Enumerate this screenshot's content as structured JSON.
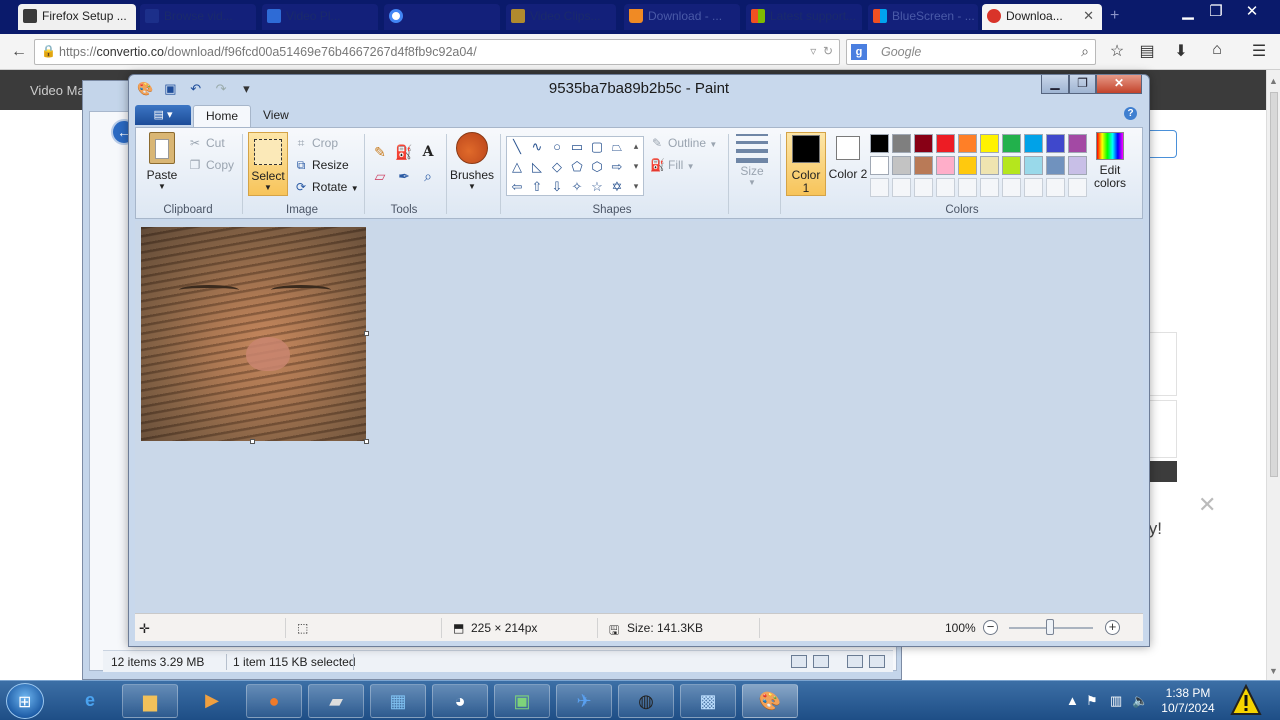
{
  "browser": {
    "tabs": [
      {
        "label": "Firefox Setup ...",
        "icon_color": "#3a3a3a"
      },
      {
        "label": "Browse vid...",
        "icon_color": "#1c2f8a"
      },
      {
        "label": "Video Pl...",
        "icon_color": "#2e6bd6"
      },
      {
        "label": "",
        "icon_color": "#ffffff"
      },
      {
        "label": "Video Clips...",
        "icon_color": "#b08a2e"
      },
      {
        "label": "Download - ...",
        "icon_color": "#f08a24"
      },
      {
        "label": "Latest support...",
        "icon_color": "#3aa14a"
      },
      {
        "label": "BlueScreen - ...",
        "icon_color": "#f25022"
      },
      {
        "label": "Downloa...",
        "icon_color": "#d9342a"
      }
    ],
    "url_prefix": "https://",
    "url_host": "convertio.co",
    "url_path": "/download/f96fcd00a51469e76b4667267d4f8fb9c92a04/",
    "search_placeholder": "Google"
  },
  "site": {
    "header_text": "Video Ma",
    "side_text": "ty!"
  },
  "explorer": {
    "status_items": "12 items 3.29 MB",
    "status_selected": "1 item 115 KB selected"
  },
  "paint": {
    "title": "9535ba7ba89b2b5c - Paint",
    "tabs": {
      "home": "Home",
      "view": "View"
    },
    "clipboard": {
      "paste": "Paste",
      "cut": "Cut",
      "copy": "Copy",
      "group": "Clipboard"
    },
    "image": {
      "select": "Select",
      "crop": "Crop",
      "resize": "Resize",
      "rotate": "Rotate",
      "group": "Image"
    },
    "tools": {
      "group": "Tools"
    },
    "brushes": "Brushes",
    "shapes": {
      "outline": "Outline",
      "fill": "Fill",
      "group": "Shapes"
    },
    "size": "Size",
    "colors": {
      "color1_label": "Color 1",
      "color2_label": "Color 2",
      "edit_colors": "Edit colors",
      "group": "Colors",
      "color1": "#000000",
      "color2": "#ffffff",
      "palette_row1": [
        "#000000",
        "#7f7f7f",
        "#880015",
        "#ed1c24",
        "#ff7f27",
        "#fff200",
        "#22b14c",
        "#00a2e8",
        "#3f48cc",
        "#a349a4"
      ],
      "palette_row2": [
        "#ffffff",
        "#c3c3c3",
        "#b97a57",
        "#ffaec9",
        "#ffc90e",
        "#efe4b0",
        "#b5e61d",
        "#99d9ea",
        "#7092be",
        "#c8bfe7"
      ]
    },
    "status": {
      "dimensions": "225 × 214px",
      "size": "Size: 141.3KB",
      "zoom": "100%",
      "zoom_level": 1.0
    }
  },
  "taskbar": {
    "time": "1:38 PM",
    "date": "10/7/2024"
  }
}
